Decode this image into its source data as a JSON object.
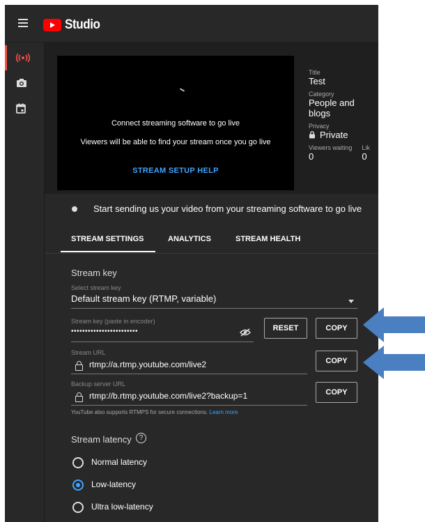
{
  "header": {
    "logo_text": "Studio"
  },
  "sidebar": {
    "items": [
      {
        "icon": "live-broadcast-icon",
        "active": true
      },
      {
        "icon": "camera-icon",
        "active": false
      },
      {
        "icon": "calendar-icon",
        "active": false
      }
    ]
  },
  "preview": {
    "message_primary": "Connect streaming software to go live",
    "message_secondary": "Viewers will be able to find your stream once you go live",
    "setup_help_label": "STREAM SETUP HELP"
  },
  "info": {
    "title_label": "Title",
    "title_value": "Test",
    "category_label": "Category",
    "category_value": "People and blogs",
    "privacy_label": "Privacy",
    "privacy_value": "Private",
    "viewers_waiting_label": "Viewers waiting",
    "viewers_waiting_value": "0",
    "likes_label": "Lik",
    "likes_value": "0"
  },
  "status": {
    "text": "Start sending us your video from your streaming software to go live"
  },
  "tabs": [
    {
      "label": "STREAM SETTINGS",
      "selected": true
    },
    {
      "label": "ANALYTICS",
      "selected": false
    },
    {
      "label": "STREAM HEALTH",
      "selected": false
    }
  ],
  "stream_key": {
    "section_title": "Stream key",
    "select_label": "Select stream key",
    "select_value": "Default stream key (RTMP, variable)",
    "key_label": "Stream key (paste in encoder)",
    "key_value": "••••••••••••••••••••••••",
    "reset_label": "RESET",
    "copy_key_label": "COPY",
    "url_label": "Stream URL",
    "url_value": "rtmp://a.rtmp.youtube.com/live2",
    "copy_url_label": "COPY",
    "backup_label": "Backup server URL",
    "backup_value": "rtmp://b.rtmp.youtube.com/live2?backup=1",
    "copy_backup_label": "COPY",
    "rtmps_note": "YouTube also supports RTMPS for secure connections.",
    "learn_more": "Learn more"
  },
  "latency": {
    "section_title": "Stream latency",
    "options": [
      {
        "label": "Normal latency",
        "selected": false
      },
      {
        "label": "Low-latency",
        "selected": true
      },
      {
        "label": "Ultra low-latency",
        "selected": false
      }
    ]
  },
  "colors": {
    "accent_red": "#ff0000",
    "link_blue": "#3ea6ff",
    "annotation_arrow": "#4a7fc1"
  }
}
